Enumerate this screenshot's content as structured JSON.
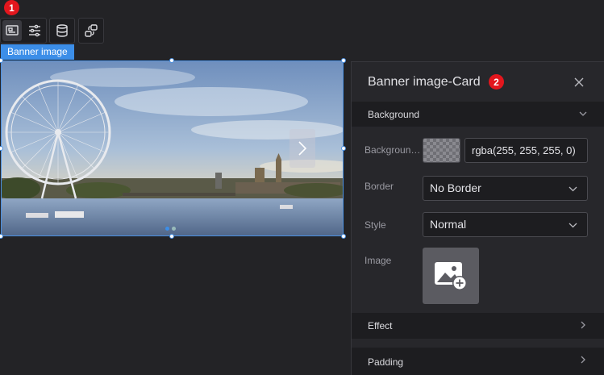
{
  "toolbar": {
    "badge": "1",
    "buttons": [
      {
        "icon": "banner-image-icon",
        "active": true
      },
      {
        "icon": "sliders-icon"
      },
      {
        "icon": "database-icon"
      },
      {
        "icon": "link-swap-icon"
      }
    ]
  },
  "component": {
    "tag_label": "Banner image"
  },
  "panel": {
    "title": "Banner image-Card",
    "badge": "2",
    "sections": {
      "background": "Background",
      "effect": "Effect",
      "padding": "Padding"
    },
    "fields": {
      "background_label": "Background color",
      "background_value": "rgba(255, 255, 255, 0)",
      "border_label": "Border",
      "border_value": "No Border",
      "style_label": "Style",
      "style_value": "Normal",
      "image_label": "Image"
    }
  },
  "colors": {
    "accent": "#3c8ee8",
    "badge": "#e3161d",
    "panel_bg": "#27272b",
    "page_bg": "#232326"
  }
}
